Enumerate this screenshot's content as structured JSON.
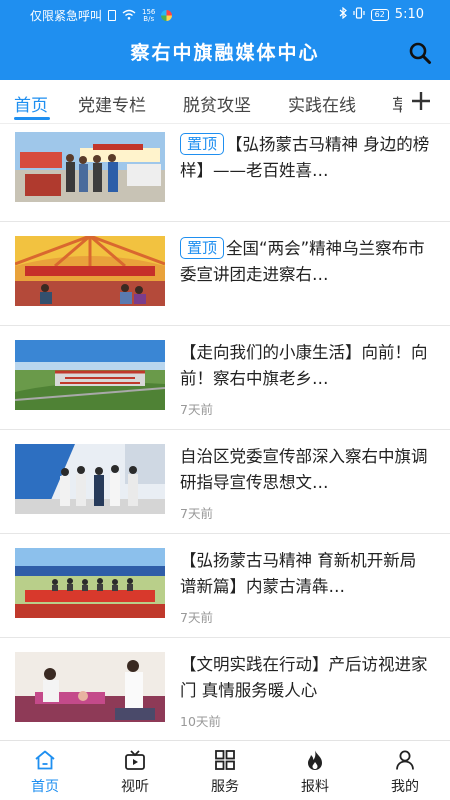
{
  "status_bar": {
    "carrier": "仅限紧急呼叫",
    "speed_value": "156",
    "speed_unit": "B/s",
    "battery": "62",
    "time": "5:10"
  },
  "header": {
    "title": "察右中旗融媒体中心",
    "search_icon": "search-icon",
    "color": "#1f8ff0"
  },
  "tabs": [
    {
      "label": "首页",
      "active": true
    },
    {
      "label": "党建专栏"
    },
    {
      "label": "脱贫攻坚"
    },
    {
      "label": "实践在线"
    },
    {
      "label": "草"
    }
  ],
  "add_tab_icon": "plus-icon",
  "news": [
    {
      "badge": "置顶",
      "title": "【弘扬蒙古马精神 身边的榜样】——老百姓喜…",
      "time": ""
    },
    {
      "badge": "置顶",
      "title": "全国“两会”精神乌兰察布市委宣讲团走进察右…",
      "time": ""
    },
    {
      "badge": "",
      "title": "【走向我们的小康生活】向前！向前！察右中旗老乡…",
      "time": "7天前"
    },
    {
      "badge": "",
      "title": "自治区党委宣传部深入察右中旗调研指导宣传思想文…",
      "time": "7天前"
    },
    {
      "badge": "",
      "title": "【弘扬蒙古马精神 育新机开新局谱新篇】内蒙古清犇…",
      "time": "7天前"
    },
    {
      "badge": "",
      "title": "【文明实践在行动】产后访视进家门 真情服务暖人心",
      "time": "10天前"
    }
  ],
  "bottom_nav": [
    {
      "label": "首页",
      "icon": "home-icon",
      "active": true
    },
    {
      "label": "视听",
      "icon": "video-icon"
    },
    {
      "label": "服务",
      "icon": "grid-icon"
    },
    {
      "label": "报料",
      "icon": "fire-icon"
    },
    {
      "label": "我的",
      "icon": "user-icon"
    }
  ]
}
